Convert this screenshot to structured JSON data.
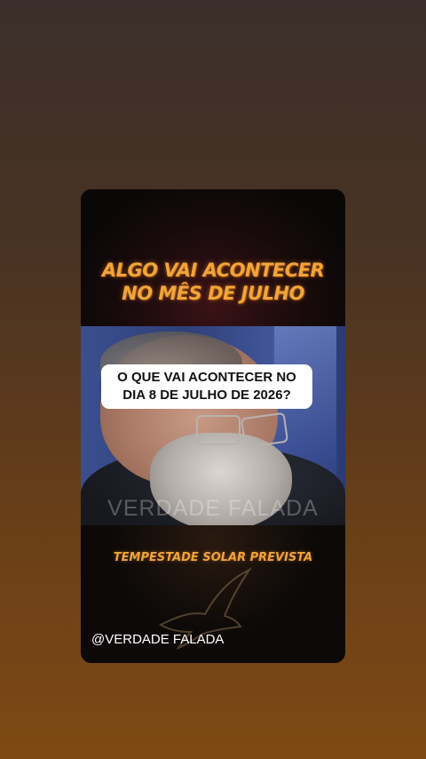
{
  "story": {
    "headline_line1": "ALGO VAI ACONTECER",
    "headline_line2": "NO MÊS DE JULHO",
    "question_line1": "O QUE VAI ACONTECER NO",
    "question_line2": "DIA 8 DE JULHO DE 2026?",
    "video_watermark": "VERDADE FALADA",
    "subtitle": "TEMPESTADE SOLAR PREVISTA",
    "channel_handle": "@VERDADE FALADA"
  },
  "colors": {
    "headline": "#f1a53b",
    "background_top": "#3b2f2b",
    "background_bottom": "#7e4914"
  },
  "icons": {
    "dove": "dove-icon"
  }
}
